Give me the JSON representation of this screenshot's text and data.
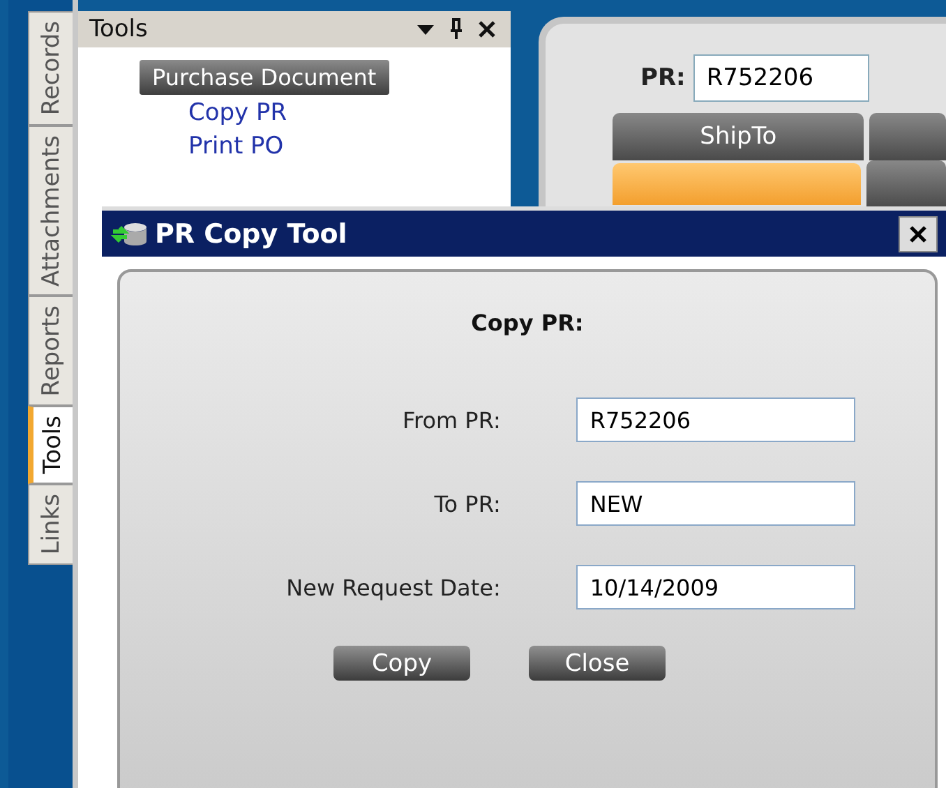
{
  "side_tabs": [
    {
      "label": "Records",
      "selected": false
    },
    {
      "label": "Attachments",
      "selected": false
    },
    {
      "label": "Reports",
      "selected": false
    },
    {
      "label": "Tools",
      "selected": true
    },
    {
      "label": "Links",
      "selected": false
    }
  ],
  "tools_panel": {
    "title": "Tools",
    "section": "Purchase Document",
    "links": [
      "Copy PR",
      "Print PO"
    ]
  },
  "record": {
    "pr_label": "PR:",
    "pr_value": "R752206",
    "tabs": [
      {
        "label": "ShipTo",
        "selected": false
      },
      {
        "selected": true
      }
    ]
  },
  "dialog": {
    "title": "PR Copy Tool",
    "heading": "Copy PR:",
    "fields": [
      {
        "label": "From PR:",
        "value": "R752206"
      },
      {
        "label": "To PR:",
        "value": "NEW"
      },
      {
        "label": "New Request Date:",
        "value": "10/14/2009"
      }
    ],
    "buttons": [
      "Copy",
      "Close"
    ]
  }
}
